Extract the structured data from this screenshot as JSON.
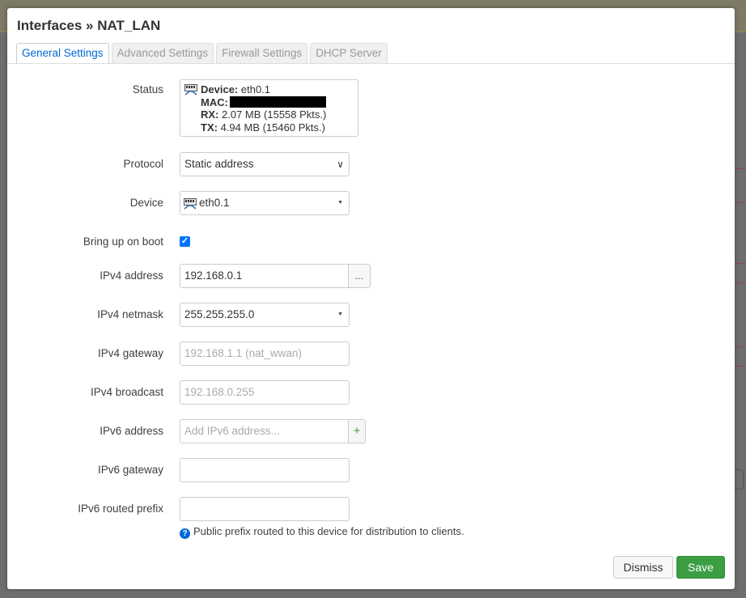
{
  "modal": {
    "title": "Interfaces » NAT_LAN",
    "tabs": [
      {
        "label": "General Settings",
        "active": true
      },
      {
        "label": "Advanced Settings",
        "active": false
      },
      {
        "label": "Firewall Settings",
        "active": false
      },
      {
        "label": "DHCP Server",
        "active": false
      }
    ]
  },
  "form": {
    "status": {
      "label": "Status",
      "device_key": "Device:",
      "device_value": "eth0.1",
      "mac_key": "MAC:",
      "rx_key": "RX:",
      "rx_value": "2.07 MB (15558 Pkts.)",
      "tx_key": "TX:",
      "tx_value": "4.94 MB (15460 Pkts.)"
    },
    "protocol": {
      "label": "Protocol",
      "value": "Static address"
    },
    "device": {
      "label": "Device",
      "value": "eth0.1"
    },
    "bring_up": {
      "label": "Bring up on boot",
      "checked": true
    },
    "ipv4_address": {
      "label": "IPv4 address",
      "value": "192.168.0.1",
      "addon": "..."
    },
    "ipv4_netmask": {
      "label": "IPv4 netmask",
      "value": "255.255.255.0"
    },
    "ipv4_gateway": {
      "label": "IPv4 gateway",
      "placeholder": "192.168.1.1 (nat_wwan)"
    },
    "ipv4_broadcast": {
      "label": "IPv4 broadcast",
      "placeholder": "192.168.0.255"
    },
    "ipv6_address": {
      "label": "IPv6 address",
      "placeholder": "Add IPv6 address...",
      "addon": "+"
    },
    "ipv6_gateway": {
      "label": "IPv6 gateway",
      "value": ""
    },
    "ipv6_prefix": {
      "label": "IPv6 routed prefix",
      "value": "",
      "help": "Public prefix routed to this device for distribution to clients."
    }
  },
  "footer": {
    "dismiss_label": "Dismiss",
    "save_label": "Save"
  },
  "colors": {
    "accent": "#0069d6",
    "save": "#3b9e43",
    "addon_plus": "#3b9e43"
  },
  "icons": {
    "network": "ethernet-port-icon",
    "help": "question-circle-icon",
    "select": "chevron-down-icon"
  }
}
